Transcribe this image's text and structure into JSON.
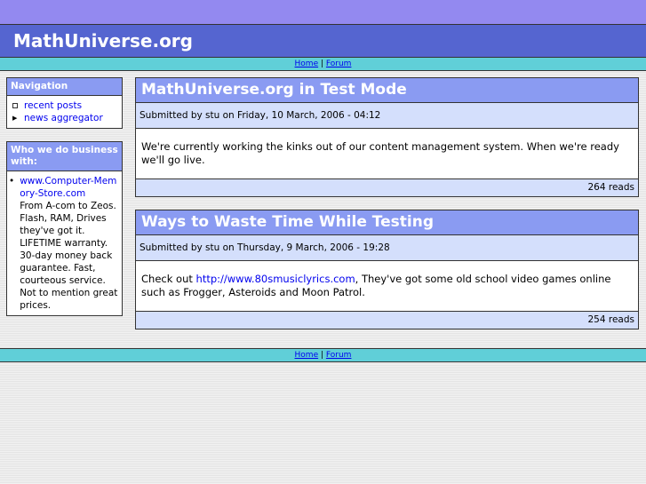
{
  "site": {
    "title": "MathUniverse.org"
  },
  "links": {
    "home": "Home",
    "sep": "|",
    "forum": "Forum"
  },
  "sidebar": {
    "navigation": {
      "title": "Navigation",
      "items": [
        {
          "label": "recent posts"
        },
        {
          "label": "news aggregator"
        }
      ]
    },
    "business": {
      "title": "Who we do business with:",
      "link": "www.Computer-Memory-Store.com",
      "description": "From A-com to Zeos. Flash, RAM, Drives they've got it. LIFETIME warranty. 30-day money back guarantee. Fast, courteous service. Not to mention great prices."
    }
  },
  "posts": [
    {
      "title": "MathUniverse.org in Test Mode",
      "submitted": "Submitted by stu on Friday, 10 March, 2006 - 04:12",
      "body": "We're currently working the kinks out of our content management system. When we're ready we'll go live.",
      "reads": "264 reads"
    },
    {
      "title": "Ways to Waste Time While Testing",
      "submitted": "Submitted by stu on Thursday, 9 March, 2006 - 19:28",
      "body_pre": "Check out ",
      "body_link": "http://www.80smusiclyrics.com",
      "body_post": ", They've got some old school video games online such as Frogger, Asteroids and Moon Patrol.",
      "reads": "254 reads"
    }
  ]
}
